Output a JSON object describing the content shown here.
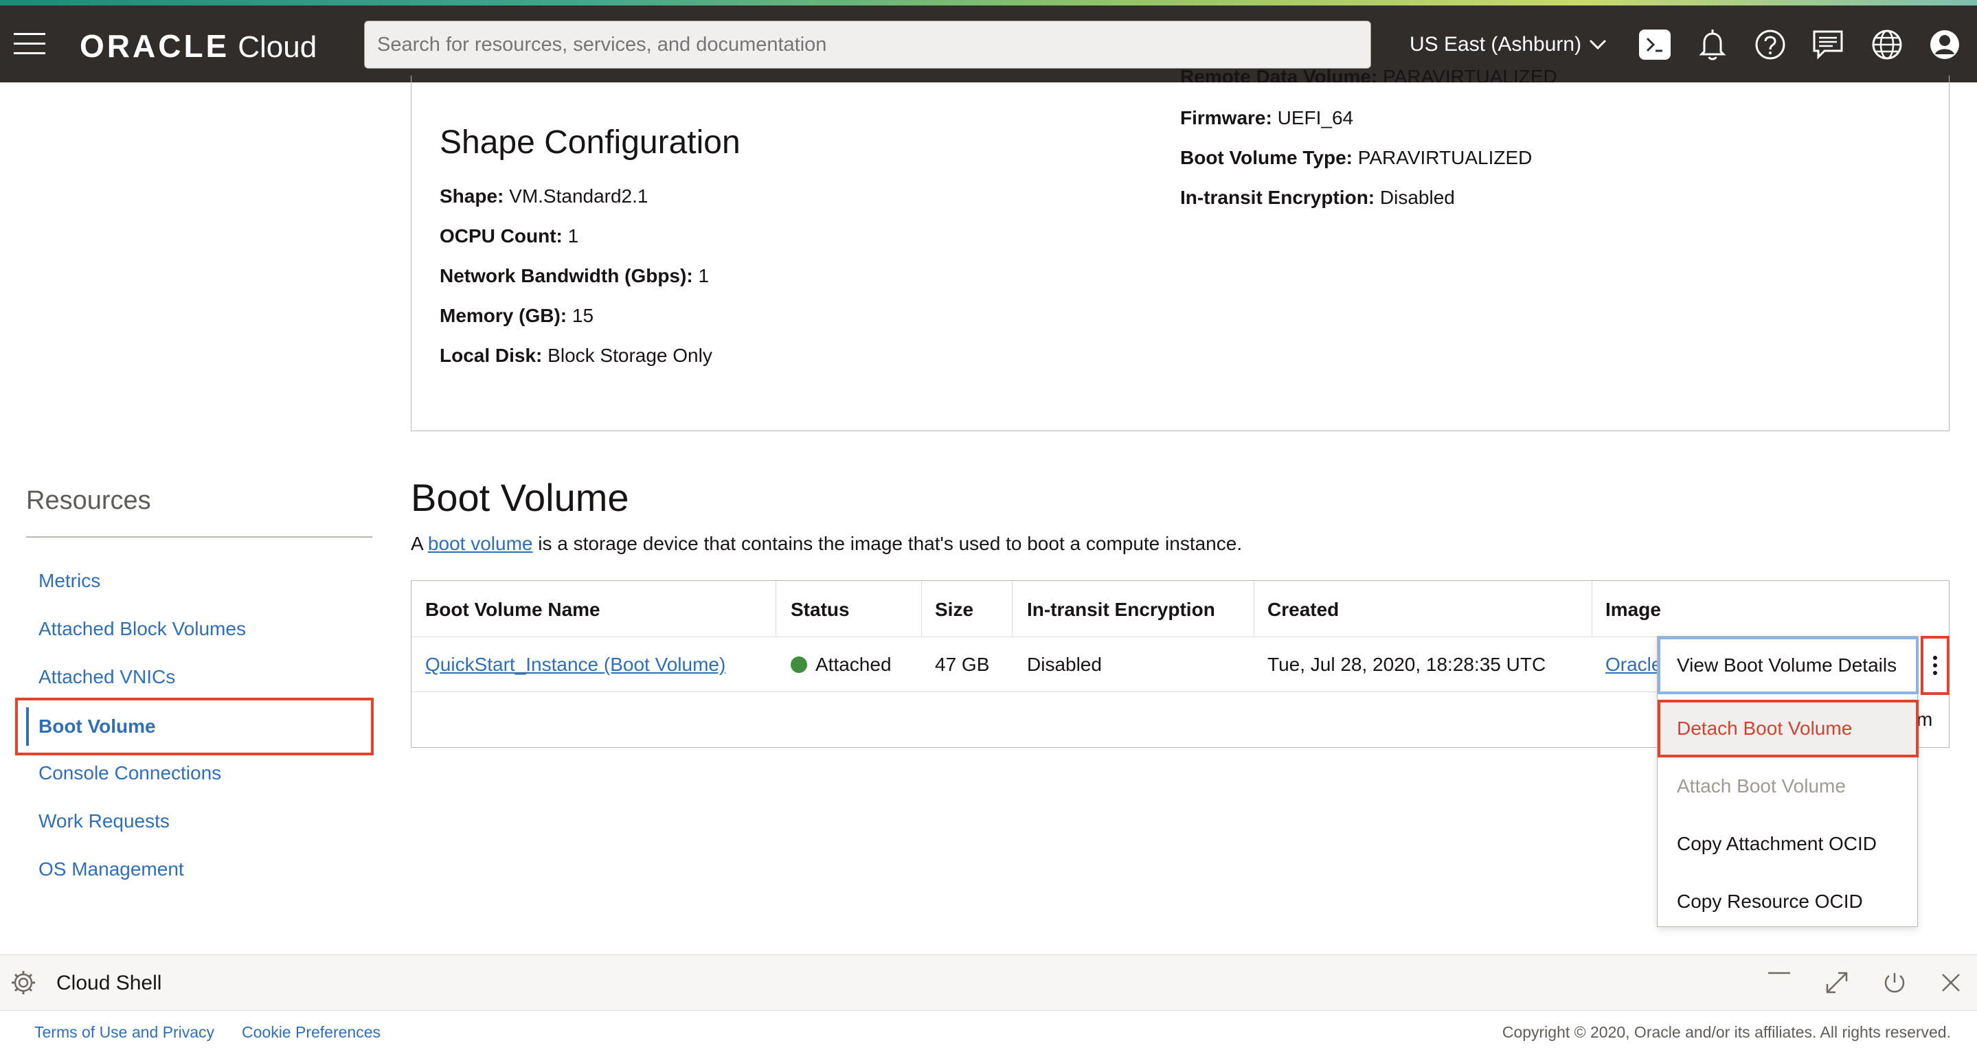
{
  "header": {
    "brand": "ORACLE",
    "product": "Cloud",
    "search_placeholder": "Search for resources, services, and documentation",
    "region": "US East (Ashburn)"
  },
  "details": {
    "cut_off_label": "Remote Data Volume:",
    "cut_off_value": "PARAVIRTUALIZED",
    "firmware_label": "Firmware:",
    "firmware_value": "UEFI_64",
    "boot_volume_type_label": "Boot Volume Type:",
    "boot_volume_type_value": "PARAVIRTUALIZED",
    "in_transit_label": "In-transit Encryption:",
    "in_transit_value": "Disabled"
  },
  "shape_config": {
    "title": "Shape Configuration",
    "fields": [
      {
        "label": "Shape:",
        "value": "VM.Standard2.1"
      },
      {
        "label": "OCPU Count:",
        "value": "1"
      },
      {
        "label": "Network Bandwidth (Gbps):",
        "value": "1"
      },
      {
        "label": "Memory (GB):",
        "value": "15"
      },
      {
        "label": "Local Disk:",
        "value": "Block Storage Only"
      }
    ]
  },
  "resources": {
    "title": "Resources",
    "items": [
      "Metrics",
      "Attached Block Volumes",
      "Attached VNICs",
      "Boot Volume",
      "Console Connections",
      "Work Requests",
      "OS Management"
    ]
  },
  "boot_volume": {
    "title": "Boot Volume",
    "desc_prefix": "A ",
    "desc_link": "boot volume",
    "desc_suffix": " is a storage device that contains the image that's used to boot a compute instance.",
    "columns": [
      "Boot Volume Name",
      "Status",
      "Size",
      "In-transit Encryption",
      "Created",
      "Image"
    ],
    "row": {
      "name": "QuickStart_Instance (Boot Volume)",
      "status": "Attached",
      "size": "47 GB",
      "encryption": "Disabled",
      "created": "Tue, Jul 28, 2020, 18:28:35 UTC",
      "image": "Oracle"
    },
    "partial_text": "m"
  },
  "menu": {
    "items": [
      "View Boot Volume Details",
      "Detach Boot Volume",
      "Attach Boot Volume",
      "Copy Attachment OCID",
      "Copy Resource OCID"
    ]
  },
  "shell": {
    "label": "Cloud Shell"
  },
  "footer": {
    "terms": "Terms of Use and Privacy",
    "cookies": "Cookie Preferences",
    "copyright": "Copyright © 2020, Oracle and/or its affiliates. All rights reserved."
  },
  "colors": {
    "header_bg": "#312d2a",
    "link": "#2f6fb7",
    "highlight": "#e2432a",
    "status_ok": "#3f8f3f"
  }
}
